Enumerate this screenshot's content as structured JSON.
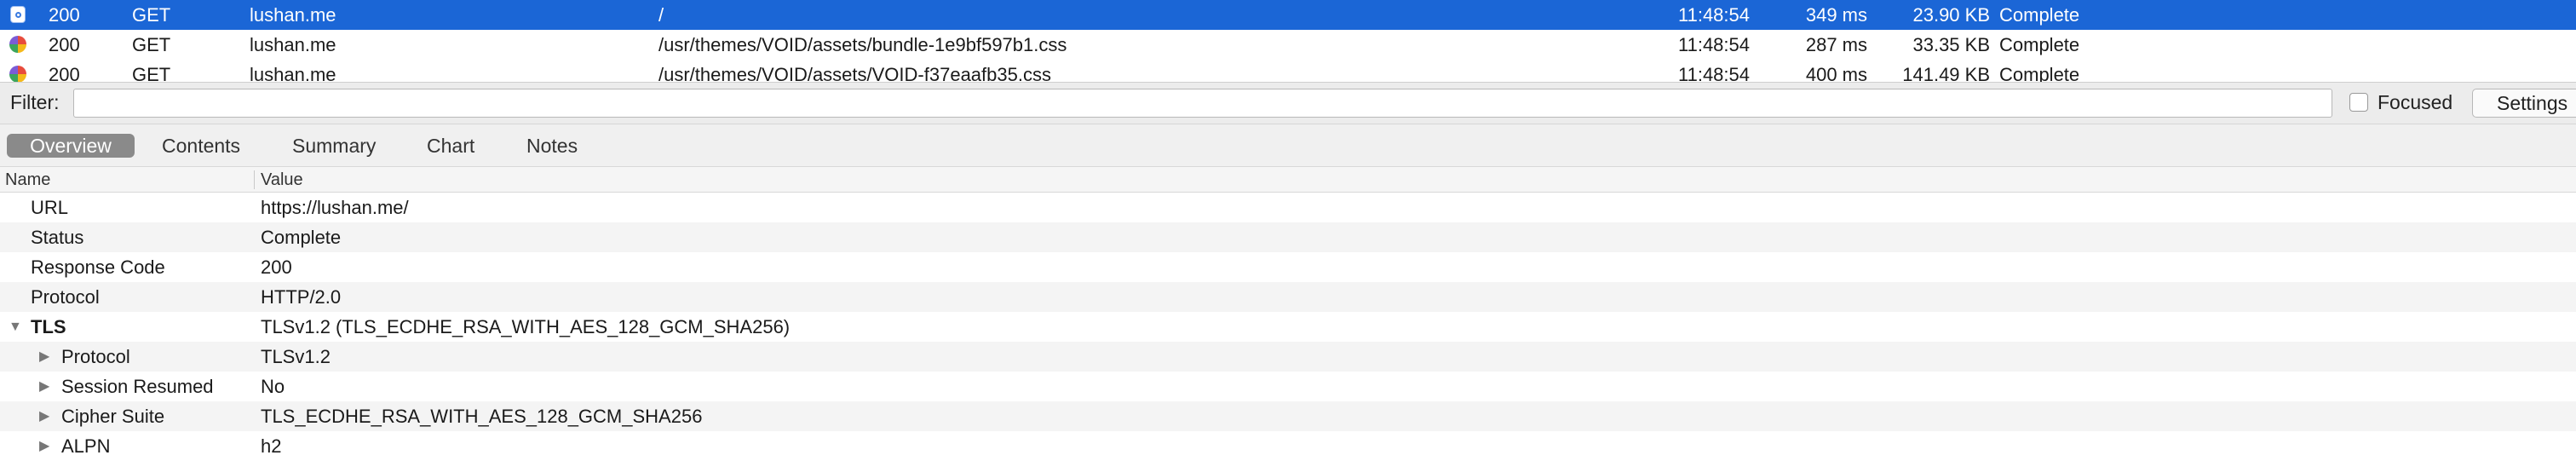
{
  "requests": [
    {
      "status": "200",
      "method": "GET",
      "host": "lushan.me",
      "path": "/",
      "time": "11:48:54",
      "duration": "349 ms",
      "size": "23.90 KB",
      "state": "Complete",
      "icon": "document-icon"
    },
    {
      "status": "200",
      "method": "GET",
      "host": "lushan.me",
      "path": "/usr/themes/VOID/assets/bundle-1e9bf597b1.css",
      "time": "11:48:54",
      "duration": "287 ms",
      "size": "33.35 KB",
      "state": "Complete",
      "icon": "stylesheet-icon"
    },
    {
      "status": "200",
      "method": "GET",
      "host": "lushan.me",
      "path": "/usr/themes/VOID/assets/VOID-f37eaafb35.css",
      "time": "11:48:54",
      "duration": "400 ms",
      "size": "141.49 KB",
      "state": "Complete",
      "icon": "stylesheet-icon"
    }
  ],
  "filter": {
    "label": "Filter:",
    "value": "",
    "focused_label": "Focused",
    "focused_checked": false,
    "settings_label": "Settings"
  },
  "tabs": [
    {
      "label": "Overview",
      "active": true
    },
    {
      "label": "Contents",
      "active": false
    },
    {
      "label": "Summary",
      "active": false
    },
    {
      "label": "Chart",
      "active": false
    },
    {
      "label": "Notes",
      "active": false
    }
  ],
  "table_header": {
    "name": "Name",
    "value": "Value"
  },
  "details": [
    {
      "name": "URL",
      "value": "https://lushan.me/"
    },
    {
      "name": "Status",
      "value": "Complete"
    },
    {
      "name": "Response Code",
      "value": "200"
    },
    {
      "name": "Protocol",
      "value": "HTTP/2.0"
    },
    {
      "name": "TLS",
      "value": "TLSv1.2 (TLS_ECDHE_RSA_WITH_AES_128_GCM_SHA256)",
      "expanded": true
    },
    {
      "name": "Protocol",
      "value": "TLSv1.2",
      "expanded": false
    },
    {
      "name": "Session Resumed",
      "value": "No",
      "expanded": false
    },
    {
      "name": "Cipher Suite",
      "value": "TLS_ECDHE_RSA_WITH_AES_128_GCM_SHA256",
      "expanded": false
    },
    {
      "name": "ALPN",
      "value": "h2",
      "expanded": false
    }
  ],
  "colors": {
    "selection": "#1b66d6",
    "active_tab": "#8a8a8a"
  }
}
